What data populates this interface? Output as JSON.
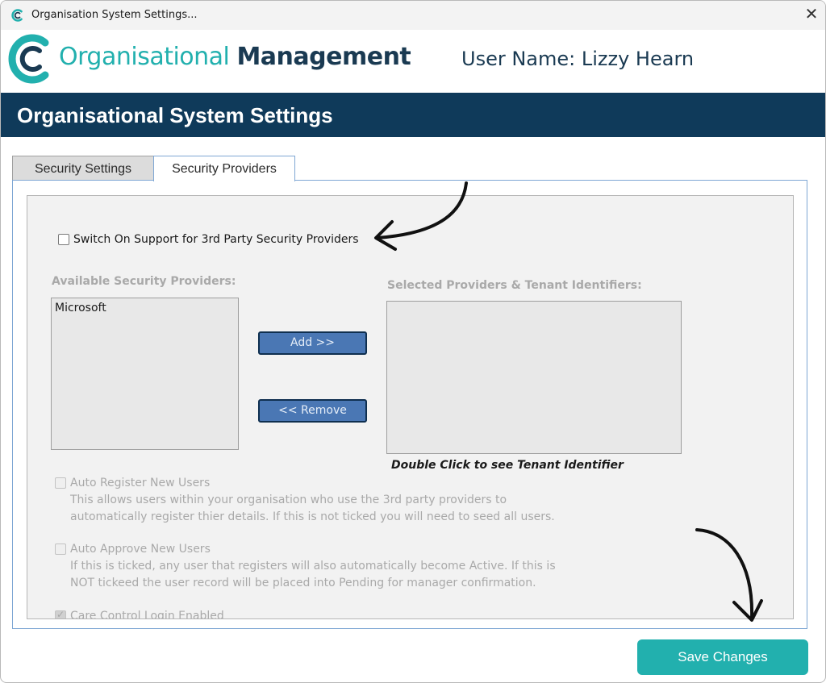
{
  "window": {
    "title": "Organisation System Settings...",
    "close_glyph": "✕"
  },
  "brand": {
    "part1": "Organisational ",
    "part2": "Management",
    "accent_color": "#22b0ae",
    "dark_color": "#1a3a52"
  },
  "user": {
    "label": "User Name: Lizzy Hearn"
  },
  "header": {
    "title": "Organisational System Settings",
    "bar_color": "#0f3a5a"
  },
  "tabs": [
    {
      "label": "Security Settings",
      "active": false
    },
    {
      "label": "Security Providers",
      "active": true
    }
  ],
  "panel": {
    "switch_checkbox_label": "Switch On Support for 3rd Party Security Providers",
    "switch_checked": false,
    "available_heading": "Available Security Providers:",
    "available_items": [
      "Microsoft"
    ],
    "selected_heading": "Selected Providers & Tenant Identifiers:",
    "selected_items": [],
    "add_label": "Add >>",
    "remove_label": "<< Remove",
    "hint": "Double Click to see Tenant Identifier",
    "auto_register_label": "Auto Register New Users",
    "auto_register_desc_1": "This allows users within your organisation who use the 3rd party providers to",
    "auto_register_desc_2": "automatically register thier details.  If this is not ticked you will need to seed all users.",
    "auto_approve_label": "Auto Approve New Users",
    "auto_approve_desc_1": "If this is ticked, any user that registers will also automatically become Active.  If this is",
    "auto_approve_desc_2": "NOT tickeed the user record will be placed into Pending for manager confirmation.",
    "care_control_label": "Care Control Login Enabled"
  },
  "footer": {
    "save_label": "Save Changes",
    "save_color": "#22b0ae"
  },
  "icons": {
    "app": "c-logo-icon",
    "close": "close-icon",
    "arrows": "hand-drawn-arrow-icon"
  }
}
